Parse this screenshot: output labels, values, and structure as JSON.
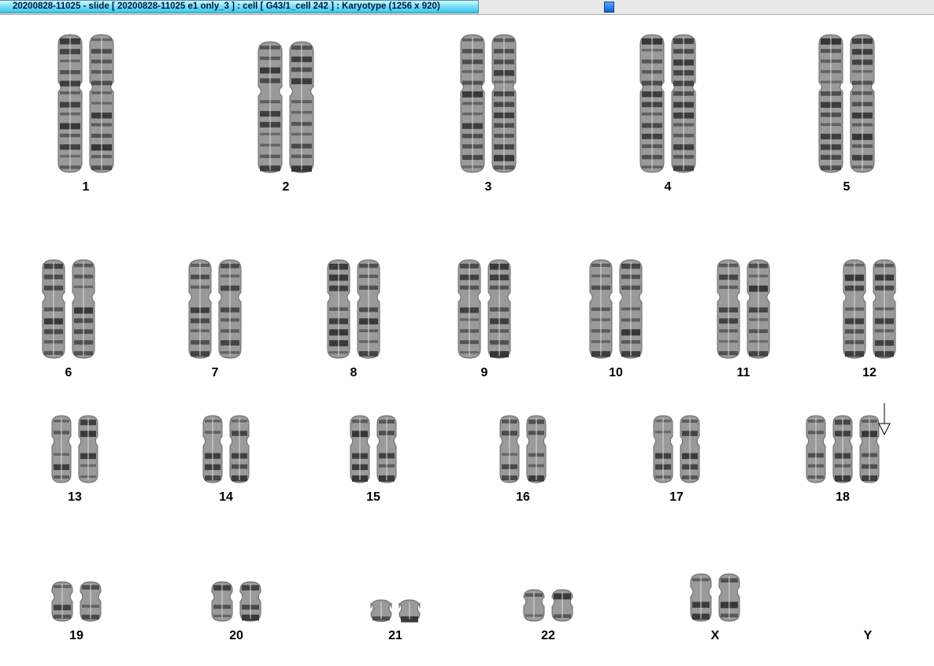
{
  "window": {
    "title": "20200828-11025 - slide [ 20200828-11025 e1 only_3 ] : cell [ G43/1_cell 242 ] : Karyotype  (1256 x 920)"
  },
  "colors": {
    "title_tab": "#35c5ea",
    "scroll_thumb": "#1061d8",
    "chromosome_ink": "#2b2b2b"
  },
  "marker": {
    "icon": "down-arrow-icon",
    "points_to": "18"
  },
  "karyotype": {
    "rows": [
      {
        "chromosomes": [
          {
            "label": "1",
            "copies": 2
          },
          {
            "label": "2",
            "copies": 2
          },
          {
            "label": "3",
            "copies": 2
          },
          {
            "label": "4",
            "copies": 2
          },
          {
            "label": "5",
            "copies": 2
          }
        ]
      },
      {
        "chromosomes": [
          {
            "label": "6",
            "copies": 2
          },
          {
            "label": "7",
            "copies": 2
          },
          {
            "label": "8",
            "copies": 2
          },
          {
            "label": "9",
            "copies": 2
          },
          {
            "label": "10",
            "copies": 2
          },
          {
            "label": "11",
            "copies": 2
          },
          {
            "label": "12",
            "copies": 2
          }
        ]
      },
      {
        "chromosomes": [
          {
            "label": "13",
            "copies": 2
          },
          {
            "label": "14",
            "copies": 2
          },
          {
            "label": "15",
            "copies": 2
          },
          {
            "label": "16",
            "copies": 2
          },
          {
            "label": "17",
            "copies": 2
          },
          {
            "label": "18",
            "copies": 3
          }
        ]
      },
      {
        "chromosomes": [
          {
            "label": "19",
            "copies": 2
          },
          {
            "label": "20",
            "copies": 2
          },
          {
            "label": "21",
            "copies": 2
          },
          {
            "label": "22",
            "copies": 2
          },
          {
            "label": "X",
            "copies": 2
          },
          {
            "label": "Y",
            "copies": 0
          }
        ]
      }
    ]
  }
}
